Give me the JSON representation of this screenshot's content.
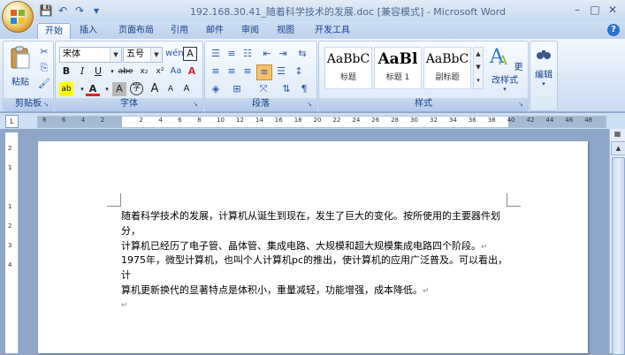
{
  "window": {
    "title": "192.168.30.41_随着科学技术的发展.doc [兼容模式] - Microsoft Word",
    "controls": {
      "minimize": "–",
      "maximize": "□",
      "close": "✕"
    }
  },
  "qat": {
    "save": "💾",
    "undo": "↶",
    "redo": "↷",
    "customize": "▾"
  },
  "tabs": [
    "开始",
    "插入",
    "页面布局",
    "引用",
    "邮件",
    "审阅",
    "视图",
    "开发工具"
  ],
  "help": "?",
  "ribbon": {
    "clipboard": {
      "paste_label": "粘贴",
      "group_label": "剪贴板"
    },
    "font": {
      "font_name": "宋体",
      "font_size": "五号",
      "group_label": "字体",
      "buttons": {
        "bold": "B",
        "italic": "I",
        "underline": "U",
        "strike": "abe",
        "sub": "x₂",
        "sup": "x²",
        "grow": "A",
        "shrink": "A",
        "clear": "A",
        "phonetic": "wén",
        "border": "A",
        "highlight": "ab",
        "color": "A",
        "shade": "A",
        "enclose": "字",
        "case": "Aa",
        "charspace": "A"
      }
    },
    "paragraph": {
      "group_label": "段落"
    },
    "styles": {
      "group_label": "样式",
      "items": [
        {
          "sample": "AaBbC",
          "name": "标题"
        },
        {
          "sample": "AaBl",
          "name": "标题 1"
        },
        {
          "sample": "AaBbC",
          "name": "副标题"
        }
      ],
      "change_label": "更改样式"
    },
    "editing": {
      "label": "编辑"
    }
  },
  "ruler": {
    "numbers": [
      "8",
      "6",
      "4",
      "2",
      "",
      "2",
      "4",
      "6",
      "8",
      "10",
      "12",
      "14",
      "16",
      "18",
      "20",
      "22",
      "24",
      "26",
      "28",
      "30",
      "32",
      "34",
      "36",
      "38",
      "40",
      "42",
      "44",
      "46",
      "48"
    ],
    "vnumbers": [
      "2",
      "1",
      "",
      "1",
      "2",
      "3",
      "4"
    ]
  },
  "document": {
    "paragraphs": [
      {
        "lines": [
          "随着科学技术的发展，计算机从诞生到现在，发生了巨大的变化。按所使用的主要器件划分，",
          "计算机已经历了电子管、晶体管、集成电路、大规模和超大规模集成电路四个阶段。"
        ]
      },
      {
        "lines": [
          "1975年，微型计算机，也叫个人计算机pc的推出，使计算机的应用广泛普及。可以看出，计",
          "算机更新换代的显著特点是体积小，重量减轻，功能增强，成本降低。"
        ]
      }
    ],
    "para_mark": "↵"
  }
}
